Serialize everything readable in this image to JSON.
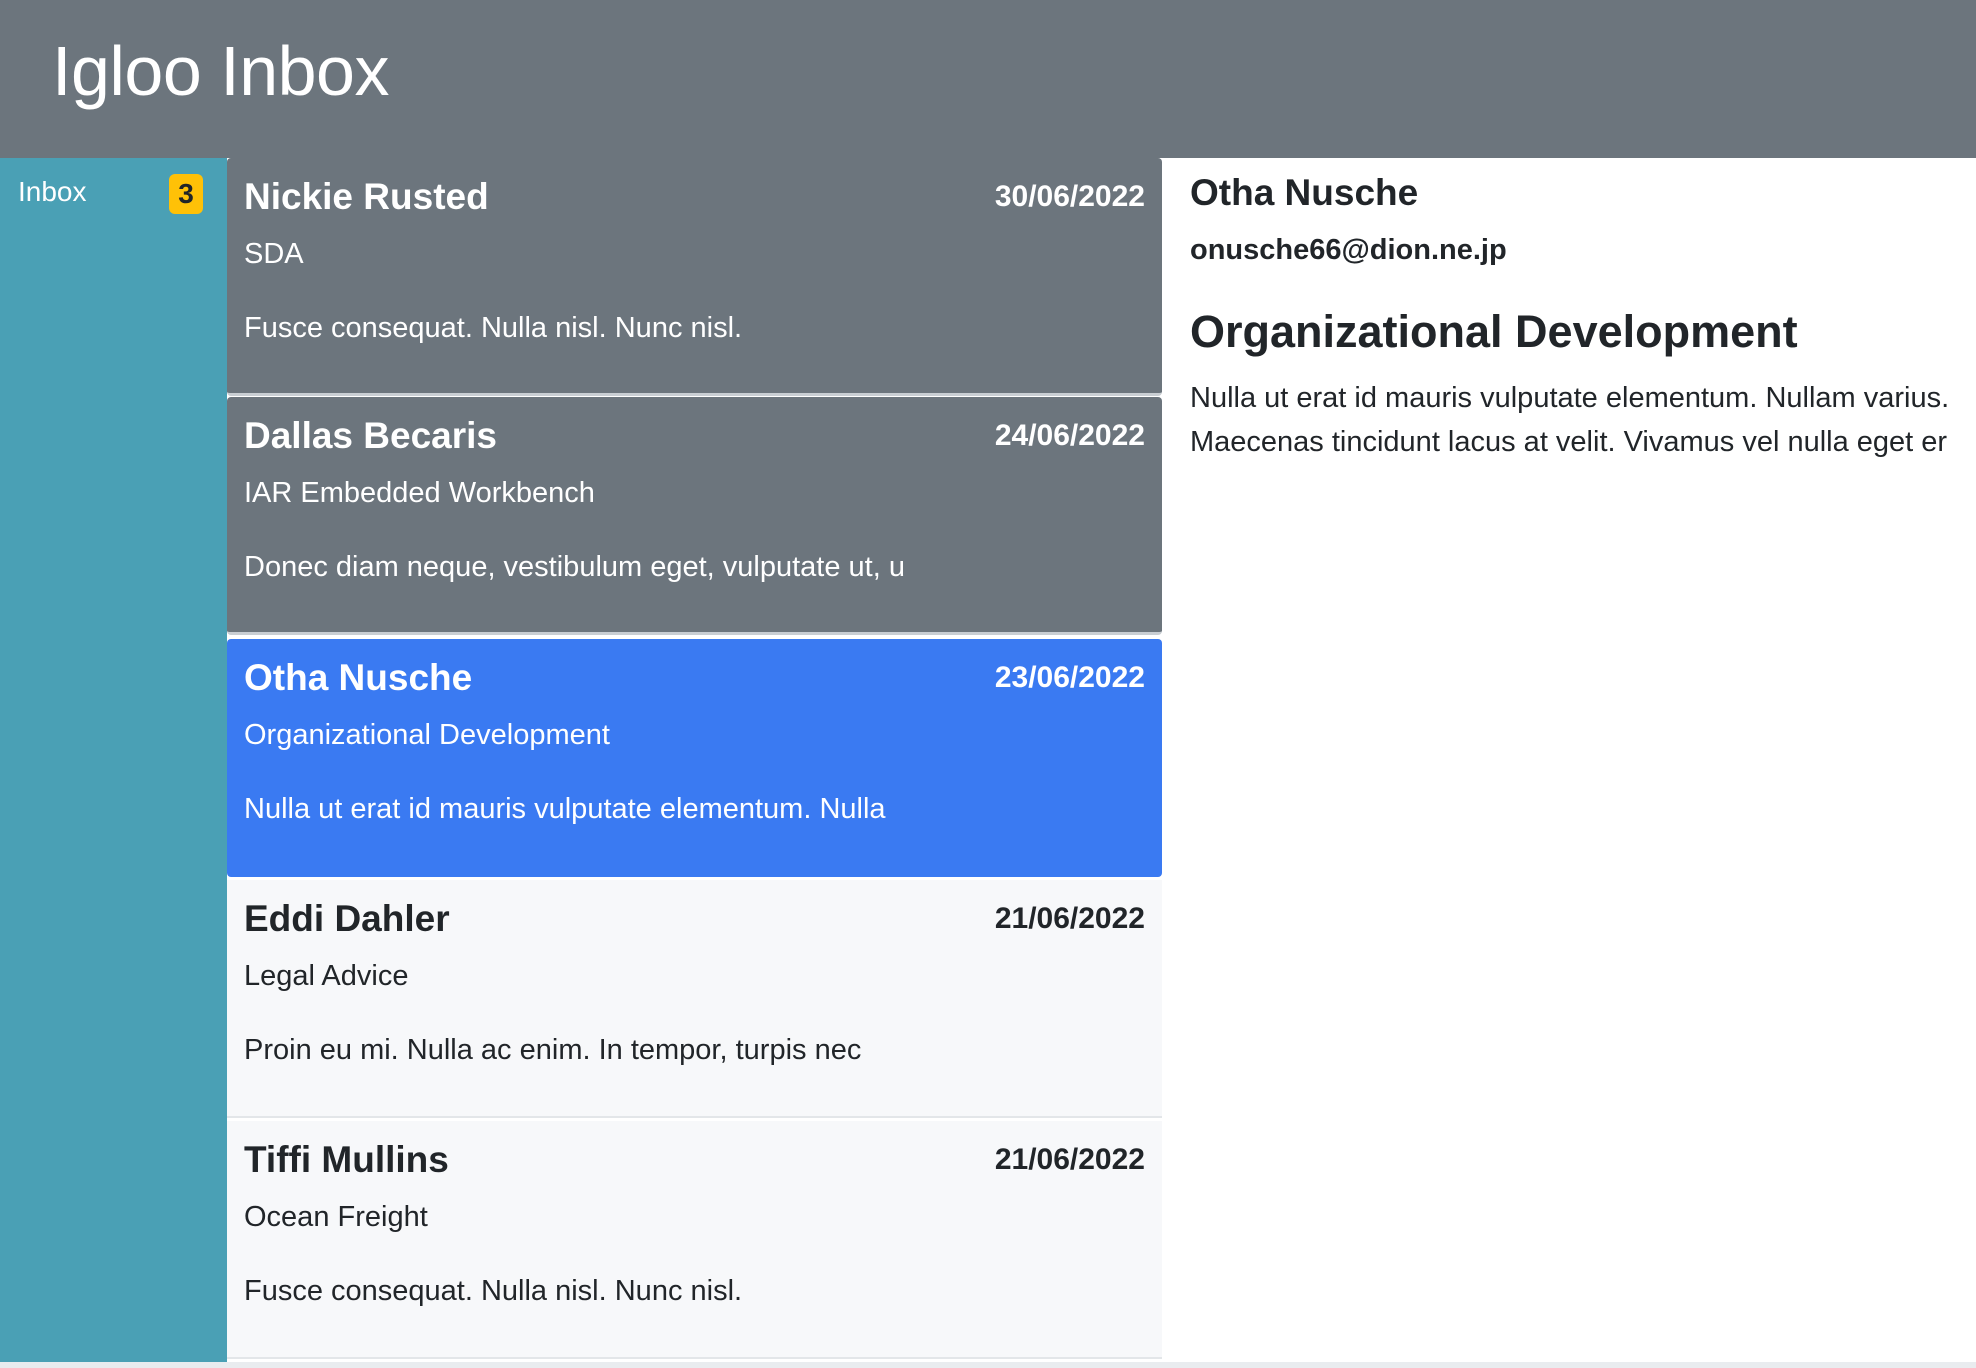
{
  "app": {
    "title": "Igloo Inbox"
  },
  "sidebar": {
    "items": [
      {
        "label": "Inbox",
        "badge": "3"
      }
    ]
  },
  "messages": [
    {
      "sender": "Nickie Rusted",
      "date": "30/06/2022",
      "subject": "SDA",
      "preview": "Fusce consequat. Nulla nisl. Nunc nisl.",
      "state": "read"
    },
    {
      "sender": "Dallas Becaris",
      "date": "24/06/2022",
      "subject": "IAR Embedded Workbench",
      "preview": "Donec diam neque, vestibulum eget, vulputate ut, u",
      "state": "read"
    },
    {
      "sender": "Otha Nusche",
      "date": "23/06/2022",
      "subject": "Organizational Development",
      "preview": "Nulla ut erat id mauris vulputate elementum. Nulla",
      "state": "active"
    },
    {
      "sender": "Eddi Dahler",
      "date": "21/06/2022",
      "subject": "Legal Advice",
      "preview": "Proin eu mi. Nulla ac enim. In tempor, turpis nec",
      "state": "unread"
    },
    {
      "sender": "Tiffi Mullins",
      "date": "21/06/2022",
      "subject": "Ocean Freight",
      "preview": "Fusce consequat. Nulla nisl. Nunc nisl.",
      "state": "unread"
    }
  ],
  "reading_pane": {
    "sender": "Otha Nusche",
    "email": "onusche66@dion.ne.jp",
    "subject": "Organizational Development",
    "body_lines": [
      "Nulla ut erat id mauris vulputate elementum. Nullam varius.",
      "Maecenas tincidunt lacus at velit. Vivamus vel nulla eget er"
    ]
  },
  "colors": {
    "header_bg": "#6c757d",
    "sidebar_bg": "#4aa0b5",
    "badge_bg": "#ffc107",
    "read_item_bg": "#6c757d",
    "active_item_bg": "#3a7af2",
    "unread_item_bg": "#f7f8fa"
  }
}
